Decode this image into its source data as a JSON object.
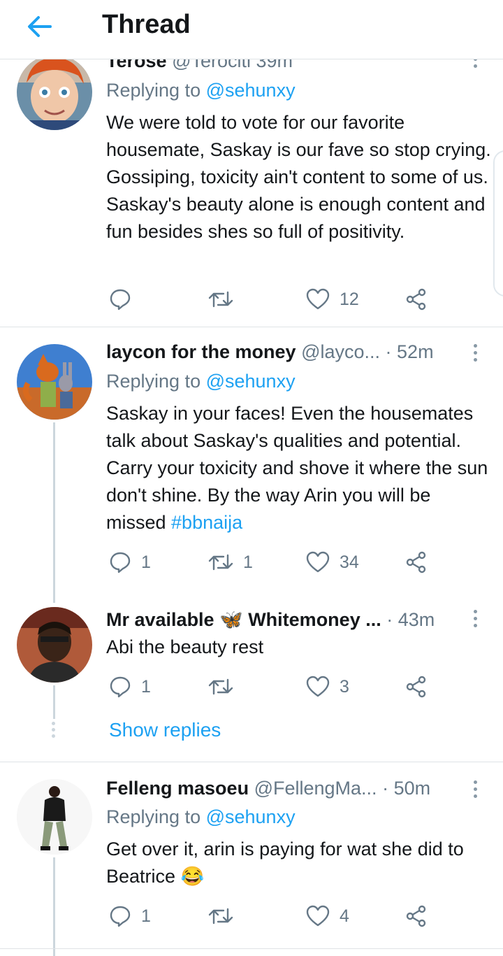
{
  "header": {
    "title": "Thread"
  },
  "tweets": [
    {
      "name": "Terose",
      "handle": "@Terociti",
      "time": "39m",
      "replying_label": "Replying to ",
      "mention": "@sehunxy",
      "text": "We were told to vote for our favorite housemate, Saskay is our fave so stop crying. Gossiping, toxicity ain't content to some of us. Saskay's beauty alone is enough content and fun besides shes so full of positivity.",
      "reply_count": "",
      "retweet_count": "",
      "like_count": "12"
    },
    {
      "name": "laycon for the money",
      "handle": "@layco...",
      "time": "· 52m",
      "replying_label": "Replying to ",
      "mention": "@sehunxy",
      "text": "Saskay in your faces! Even the housemates talk about Saskay's qualities and potential. Carry your toxicity and shove it where the sun don't shine. By the way Arin you will be missed ",
      "hashtag": "#bbnaija",
      "reply_count": "1",
      "retweet_count": "1",
      "like_count": "34"
    },
    {
      "name": "Mr available 🦋 Whitemoney ...",
      "time": "· 43m",
      "text": "Abi the beauty rest",
      "reply_count": "1",
      "retweet_count": "",
      "like_count": "3"
    },
    {
      "name": "Felleng masoeu",
      "handle": "@FellengMa...",
      "time": "· 50m",
      "replying_label": "Replying to ",
      "mention": "@sehunxy",
      "text": "Get over it, arin is paying for wat she did to Beatrice 😂",
      "reply_count": "1",
      "retweet_count": "",
      "like_count": "4"
    }
  ],
  "show_replies": "Show replies",
  "icons": [
    "back-arrow-icon",
    "reply-icon",
    "retweet-icon",
    "like-icon",
    "share-icon",
    "more-options-icon"
  ],
  "colors": {
    "accent": "#1da1f2",
    "text": "#14171a",
    "secondary": "#657786",
    "divider": "#dfe3e6"
  }
}
